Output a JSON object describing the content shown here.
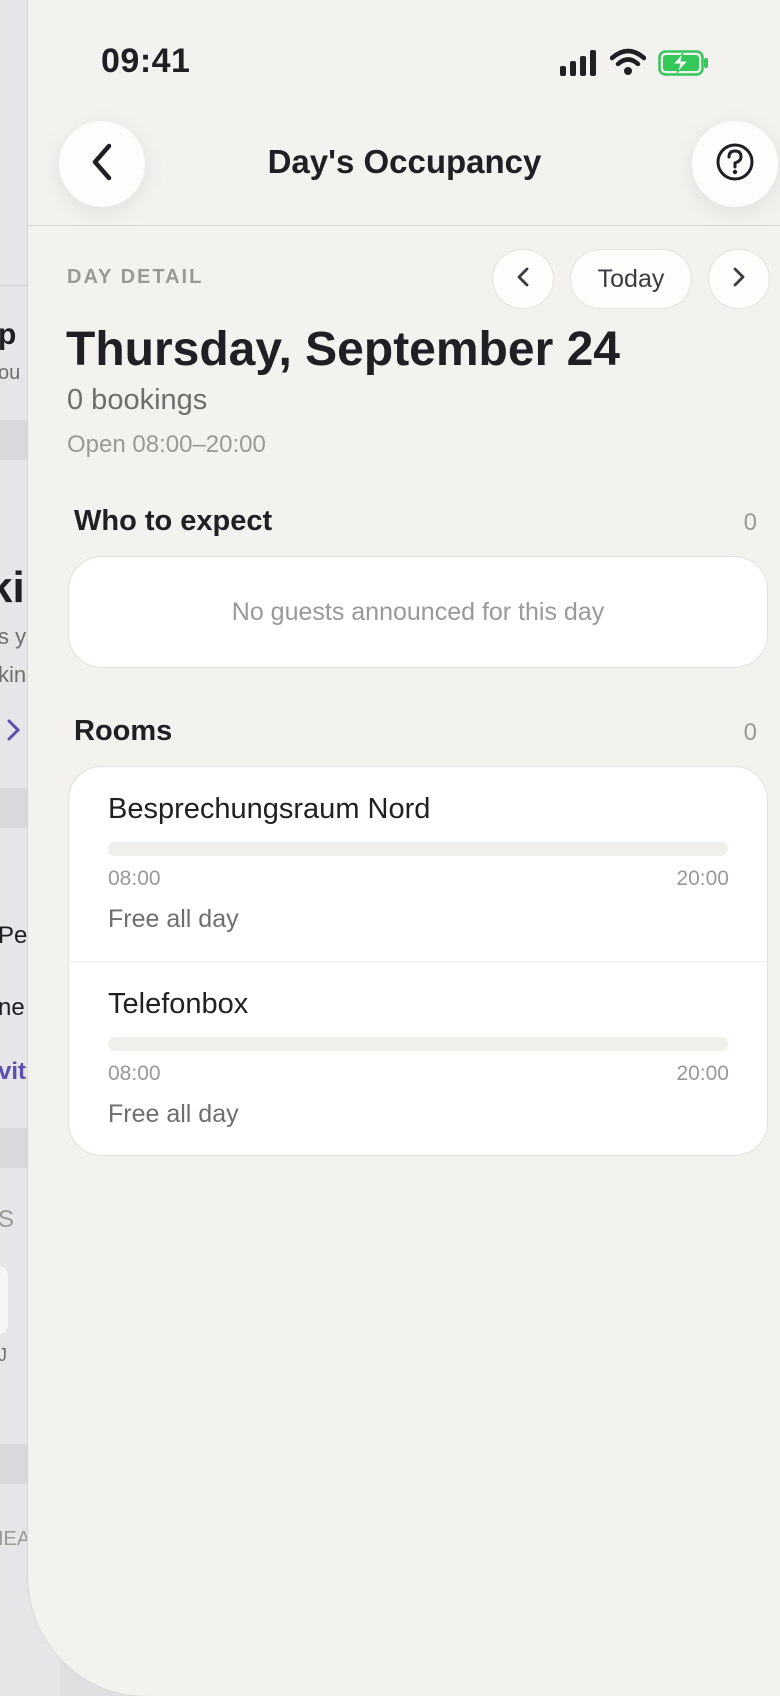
{
  "status_bar": {
    "time": "09:41"
  },
  "nav": {
    "title": "Day's Occupancy",
    "back_icon": "chevron-left-icon",
    "help_icon": "question-circle-icon"
  },
  "day": {
    "section_label": "DAY DETAIL",
    "today_label": "Today",
    "date_title": "Thursday, September 24",
    "bookings": "0 bookings",
    "hours": "Open 08:00–20:00"
  },
  "expect": {
    "title": "Who to expect",
    "count": "0",
    "empty_text": "No guests announced for this day"
  },
  "rooms": {
    "title": "Rooms",
    "count": "0",
    "items": [
      {
        "name": "Besprechungsraum Nord",
        "start": "08:00",
        "end": "20:00",
        "status": "Free all day",
        "occupancy": 0
      },
      {
        "name": "Telefonbox",
        "start": "08:00",
        "end": "20:00",
        "status": "Free all day",
        "occupancy": 0
      }
    ]
  },
  "background_page": {
    "fragments": [
      "p",
      "ou",
      "ki",
      "s y",
      "kin",
      "Pe",
      "ne",
      "vit",
      "S",
      "J",
      "IEA"
    ]
  },
  "colors": {
    "sheet_bg": "#f3f2ef",
    "card_bg": "#ffffff",
    "accent": "#5b4fb3",
    "battery_green": "#34c759"
  }
}
